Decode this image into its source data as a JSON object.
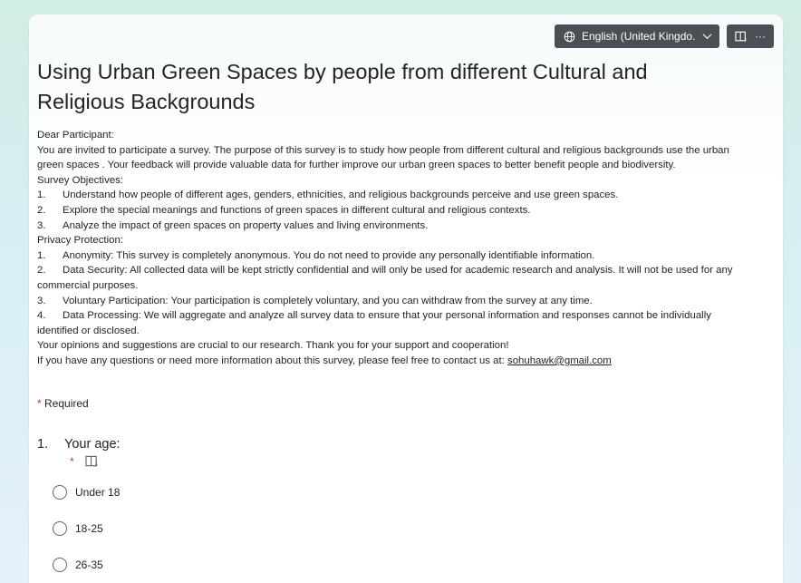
{
  "header": {
    "language_label": "English (United Kingdo...",
    "language_icon": "globe-icon",
    "chevron_icon": "chevron-down-icon",
    "reader_icon": "immersive-reader-icon",
    "more_label": "···"
  },
  "form": {
    "title": "Using Urban Green Spaces by people from different Cultural and Religious Backgrounds",
    "description": {
      "greeting": "Dear Participant:",
      "intro": "You are invited to participate a survey. The purpose of this survey is to study how people from different cultural and religious backgrounds use the urban green spaces . Your feedback will provide valuable data for further improve our urban green spaces to better benefit people and biodiversity.",
      "objectives_heading": "Survey Objectives:",
      "objectives": [
        {
          "num": "1.",
          "text": "Understand how people of different ages, genders, ethnicities, and religious backgrounds perceive and use green spaces."
        },
        {
          "num": "2.",
          "text": "Explore the special meanings and functions of green spaces in different cultural and religious contexts."
        },
        {
          "num": "3.",
          "text": "Analyze the impact of green spaces on property values and living environments."
        }
      ],
      "privacy_heading": "Privacy Protection:",
      "privacy": [
        {
          "num": "1.",
          "text": "Anonymity: This survey is completely anonymous. You do not need to provide any personally identifiable information."
        },
        {
          "num": "2.",
          "text": "Data Security: All collected data will be kept strictly confidential and will only be used for academic research and analysis. It will not be used for any commercial purposes."
        },
        {
          "num": "3.",
          "text": "Voluntary Participation: Your participation is completely voluntary, and you can withdraw from the survey at any time."
        },
        {
          "num": "4.",
          "text": "Data Processing: We will aggregate and analyze all survey data to ensure that your personal information and responses cannot be individually identified or disclosed."
        }
      ],
      "closing": "Your opinions and suggestions are crucial to our research. Thank you for your support and cooperation!",
      "contact_prefix": "If you have any questions or need more information about this survey, please feel free to contact us at: ",
      "contact_email": "sohuhawk@gmail.com"
    },
    "required_star": "*",
    "required_label": "Required",
    "questions": [
      {
        "num": "1.",
        "text": "Your age:",
        "required_star": "*",
        "options": [
          "Under 18",
          "18-25",
          "26-35"
        ]
      }
    ]
  },
  "colors": {
    "required_star": "#c4314b",
    "toolbar_bg": "#4a4f55"
  }
}
